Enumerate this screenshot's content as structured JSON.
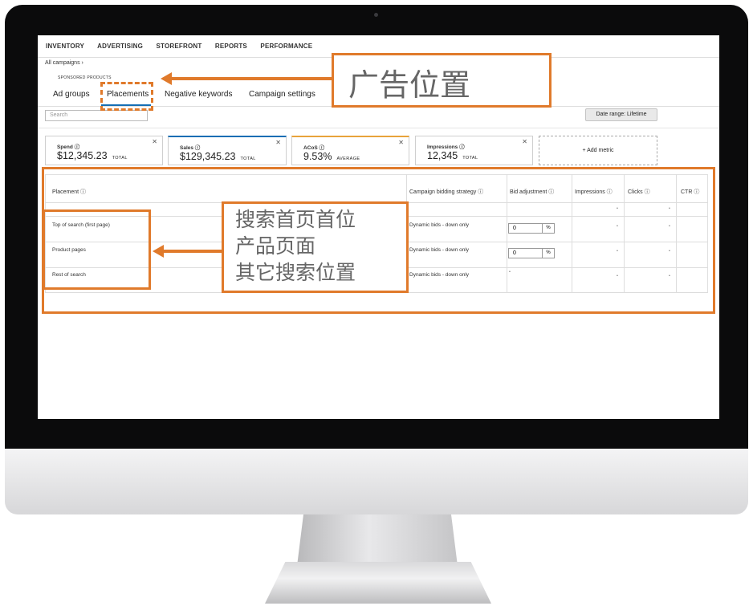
{
  "topnav": [
    "INVENTORY",
    "ADVERTISING",
    "STOREFRONT",
    "REPORTS",
    "PERFORMANCE"
  ],
  "breadcrumb": "All campaigns ›",
  "subtitle": "SPONSORED PRODUCTS",
  "tabs": [
    "Ad groups",
    "Placements",
    "Negative keywords",
    "Campaign settings"
  ],
  "active_tab": "Placements",
  "search": {
    "placeholder": "Search"
  },
  "date_range": "Date range: Lifetime",
  "metrics": [
    {
      "label": "Spend ⓘ",
      "value": "$12,345.23",
      "unit": "TOTAL"
    },
    {
      "label": "Sales ⓘ",
      "value": "$129,345.23",
      "unit": "TOTAL"
    },
    {
      "label": "ACoS ⓘ",
      "value": "9.53%",
      "unit": "AVERAGE"
    },
    {
      "label": "Impressions ⓘ",
      "value": "12,345",
      "unit": "TOTAL"
    }
  ],
  "add_metric": "+ Add metric",
  "table": {
    "headers": [
      "Placement ⓘ",
      "Campaign bidding strategy ⓘ",
      "Bid adjustment ⓘ",
      "Impressions ⓘ",
      "Clicks ⓘ",
      "CTR ⓘ"
    ],
    "rows": [
      {
        "placement": "Top of search (first page)",
        "strategy": "Dynamic bids - down only",
        "bid": "0",
        "pct": "%"
      },
      {
        "placement": "Product pages",
        "strategy": "Dynamic bids - down only",
        "bid": "0",
        "pct": "%"
      },
      {
        "placement": "Rest of search",
        "strategy": "Dynamic bids - down only"
      }
    ]
  },
  "annotations": {
    "title": "广告位置",
    "lines": [
      "搜索首页首位",
      "产品页面",
      "其它搜索位置"
    ]
  },
  "colors": {
    "accent": "#e07a2b",
    "tab_blue": "#146eb4",
    "bezel": "#0b0b0c"
  }
}
